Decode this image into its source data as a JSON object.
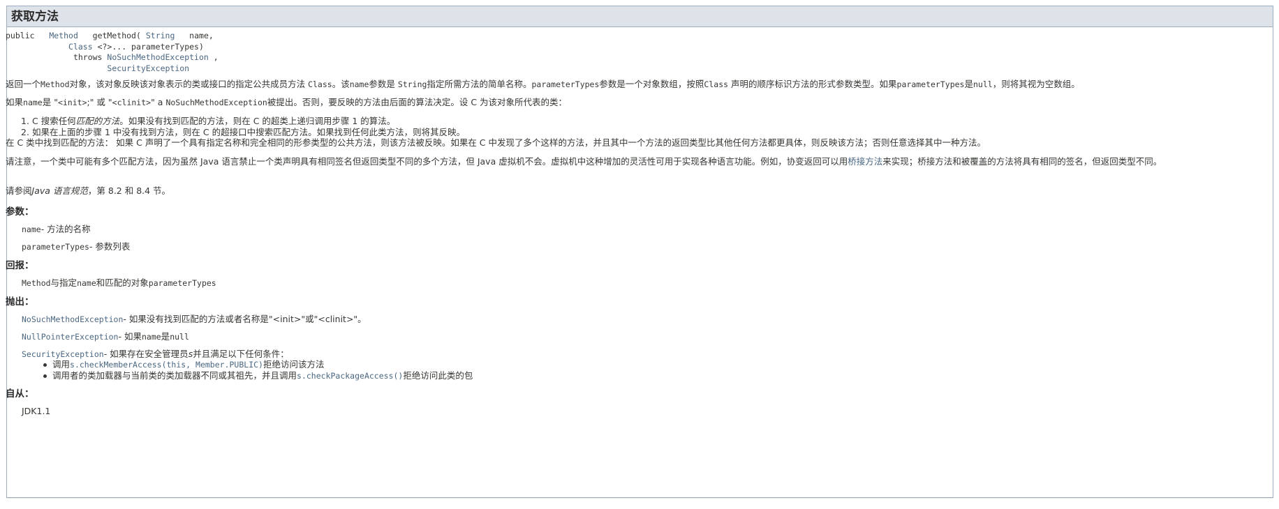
{
  "section_title": "获取方法",
  "signature": {
    "public": "public",
    "return_type": "Method",
    "method_name": "getMethod(",
    "param1_type": "String",
    "param1_name": "name,",
    "param2_type": "Class",
    "param2_rest": "<?>... parameterTypes)",
    "throws": "throws",
    "exception1": "NoSuchMethodException",
    "comma": ",",
    "exception2": "SecurityException"
  },
  "desc1": {
    "a": "返回一个",
    "b": "Method",
    "c": "对象，该对象反映该对象表示的类或接口的指定公共成员方法",
    "d": "Class",
    "e": "。该",
    "f": "name",
    "g": "参数是",
    "h": "String",
    "i": "指定所需方法的简单名称。",
    "j": "parameterTypes",
    "k": "参数是一个对象数组，按照",
    "l": "Class",
    "m": "声明的顺序标识方法的形式参数类型。如果",
    "n": "parameterTypes",
    "o": "是",
    "p": "null",
    "q": "，则将其视为空数组。"
  },
  "desc2": {
    "a": "如果",
    "b": "name",
    "c": "是 \"",
    "d": "<init>",
    "e": ";\" 或 \"",
    "f": "<clinit>",
    "g": "\" a",
    "h": "NoSuchMethodException",
    "i": "被提出。否则，要反映的方法由后面的算法决定。设 C 为该对象所代表的类："
  },
  "algo": [
    {
      "num": "1.",
      "a": "C 搜索任何",
      "b": "匹配的方法",
      "c": "。如果没有找到匹配的方法，则在 C 的超类上递归调用步骤 1 的算法。"
    },
    {
      "num": "2.",
      "a": "如果在上面的步骤 1 中没有找到方法，则在 C 的超接口中搜索匹配方法。如果找到任何此类方法，则将其反映。",
      "b": "",
      "c": ""
    }
  ],
  "desc3": "在 C 类中找到匹配的方法： 如果 C 声明了一个具有指定名称和完全相同的形参类型的公共方法，则该方法被反映。如果在 C 中发现了多个这样的方法，并且其中一个方法的返回类型比其他任何方法都更具体，则反映该方法；否则任意选择其中一种方法。",
  "desc4": {
    "a": "请注意，一个类中可能有多个匹配方法，因为虽然 Java 语言禁止一个类声明具有相同签名但返回类型不同的多个方法，但 Java 虚拟机不会。虚拟机中这种增加的灵活性可用于实现各种语言功能。例如，协变返回可以用",
    "link": "桥接方法",
    "b": "来实现；桥接方法和被覆盖的方法将具有相同的签名，但返回类型不同。"
  },
  "desc5": {
    "a": "请参阅",
    "b": "Java 语言规范",
    "c": "，第 8.2 和 8.4 节。"
  },
  "params": {
    "label": "参数：",
    "p1_name": "name",
    "p1_desc": "- 方法的名称",
    "p2_name": "parameterTypes",
    "p2_desc": "- 参数列表"
  },
  "returns": {
    "label": "回报：",
    "a": "Method",
    "b": "与指定",
    "c": "name",
    "d": "和匹配的对象",
    "e": "parameterTypes"
  },
  "throws": {
    "label": "抛出：",
    "t1_name": "NoSuchMethodException",
    "t1_desc": "- 如果没有找到匹配的方法或者名称是\"<init>\"或\"<clinit>\"。",
    "t2_name": "NullPointerException",
    "t2_desc_a": "- 如果",
    "t2_desc_b": "name",
    "t2_desc_c": "是",
    "t2_desc_d": "null",
    "t3_name": "SecurityException",
    "t3_desc_a": "- 如果存在安全管理员",
    "t3_desc_b": "s",
    "t3_desc_c": "并且满足以下任何条件：",
    "b1_a": "调用",
    "b1_b": "s.checkMemberAccess(this, Member.PUBLIC)",
    "b1_c": "拒绝访问该方法",
    "b2_a": "调用者的类加载器与当前类的类加载器不同或其祖先，并且调用",
    "b2_b": "s.checkPackageAccess()",
    "b2_c": "拒绝访问此类的包"
  },
  "since": {
    "label": "自从：",
    "value": "JDK1.1"
  }
}
